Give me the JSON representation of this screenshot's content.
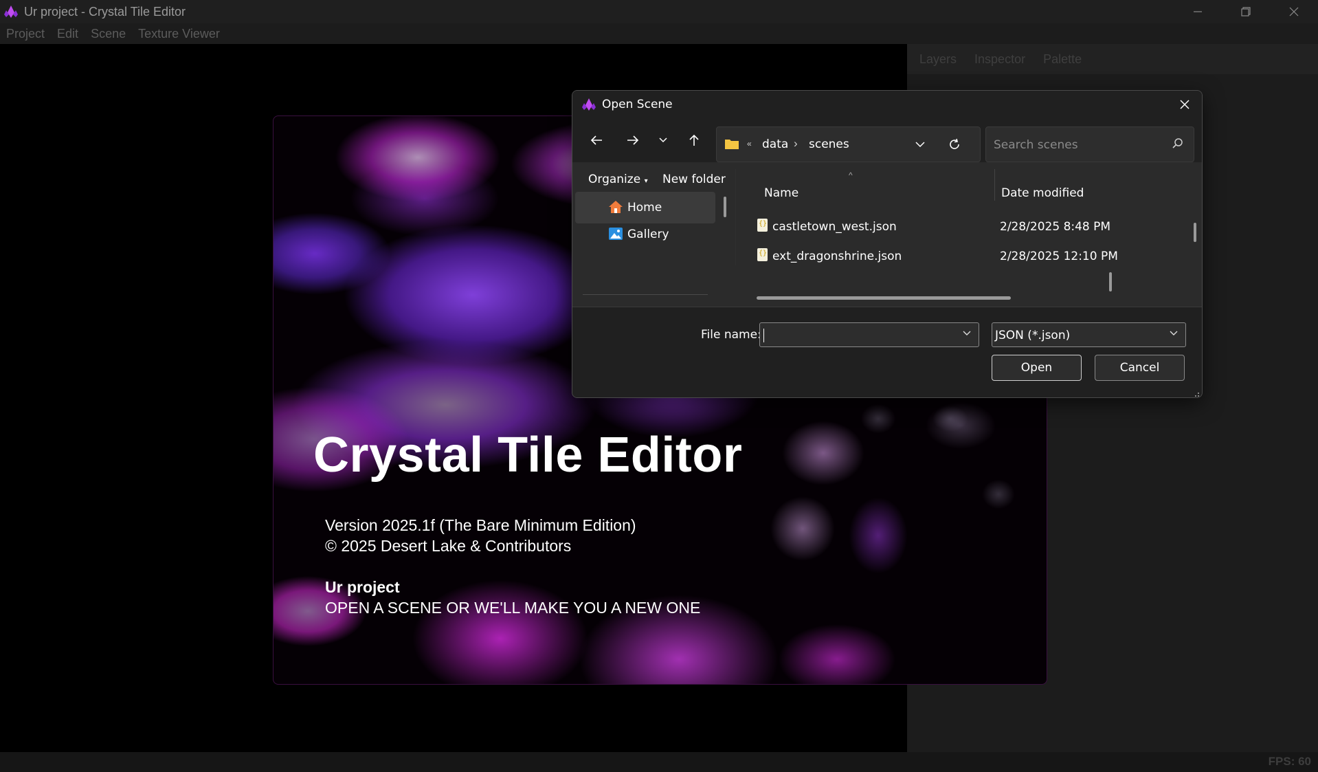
{
  "window": {
    "title": "Ur project - Crystal Tile Editor",
    "controls": [
      "minimize-icon",
      "restore-icon",
      "close-icon"
    ]
  },
  "menu": {
    "items": [
      "Project",
      "Edit",
      "Scene",
      "Texture Viewer"
    ]
  },
  "right_panel": {
    "tabs": [
      "Layers",
      "Inspector",
      "Palette"
    ]
  },
  "status": {
    "fps": "FPS: 60"
  },
  "splash": {
    "title": "Crystal Tile Editor",
    "version": "Version 2025.1f (The Bare Minimum Edition)",
    "copyright": "© 2025 Desert Lake & Contributors",
    "project_name": "Ur project",
    "message": "OPEN A SCENE OR WE'LL MAKE YOU A NEW ONE"
  },
  "dialog": {
    "title": "Open Scene",
    "breadcrumb": [
      "data",
      "scenes"
    ],
    "breadcrumb_overflow": "«",
    "search_placeholder": "Search scenes",
    "commands": {
      "organize": "Organize",
      "new_folder": "New folder"
    },
    "nav_items": [
      {
        "label": "Home",
        "icon": "home-icon",
        "selected": true
      },
      {
        "label": "Gallery",
        "icon": "gallery-icon",
        "selected": false
      }
    ],
    "columns": {
      "name": "Name",
      "date": "Date modified"
    },
    "files": [
      {
        "name": "castletown_west.json",
        "date": "2/28/2025 8:48 PM"
      },
      {
        "name": "ext_dragonshrine.json",
        "date": "2/28/2025 12:10 PM"
      }
    ],
    "file_name_label": "File name:",
    "file_name_value": "",
    "file_type": "JSON (*.json)",
    "open_label": "Open",
    "cancel_label": "Cancel",
    "accent_color": "#1e90ff"
  }
}
